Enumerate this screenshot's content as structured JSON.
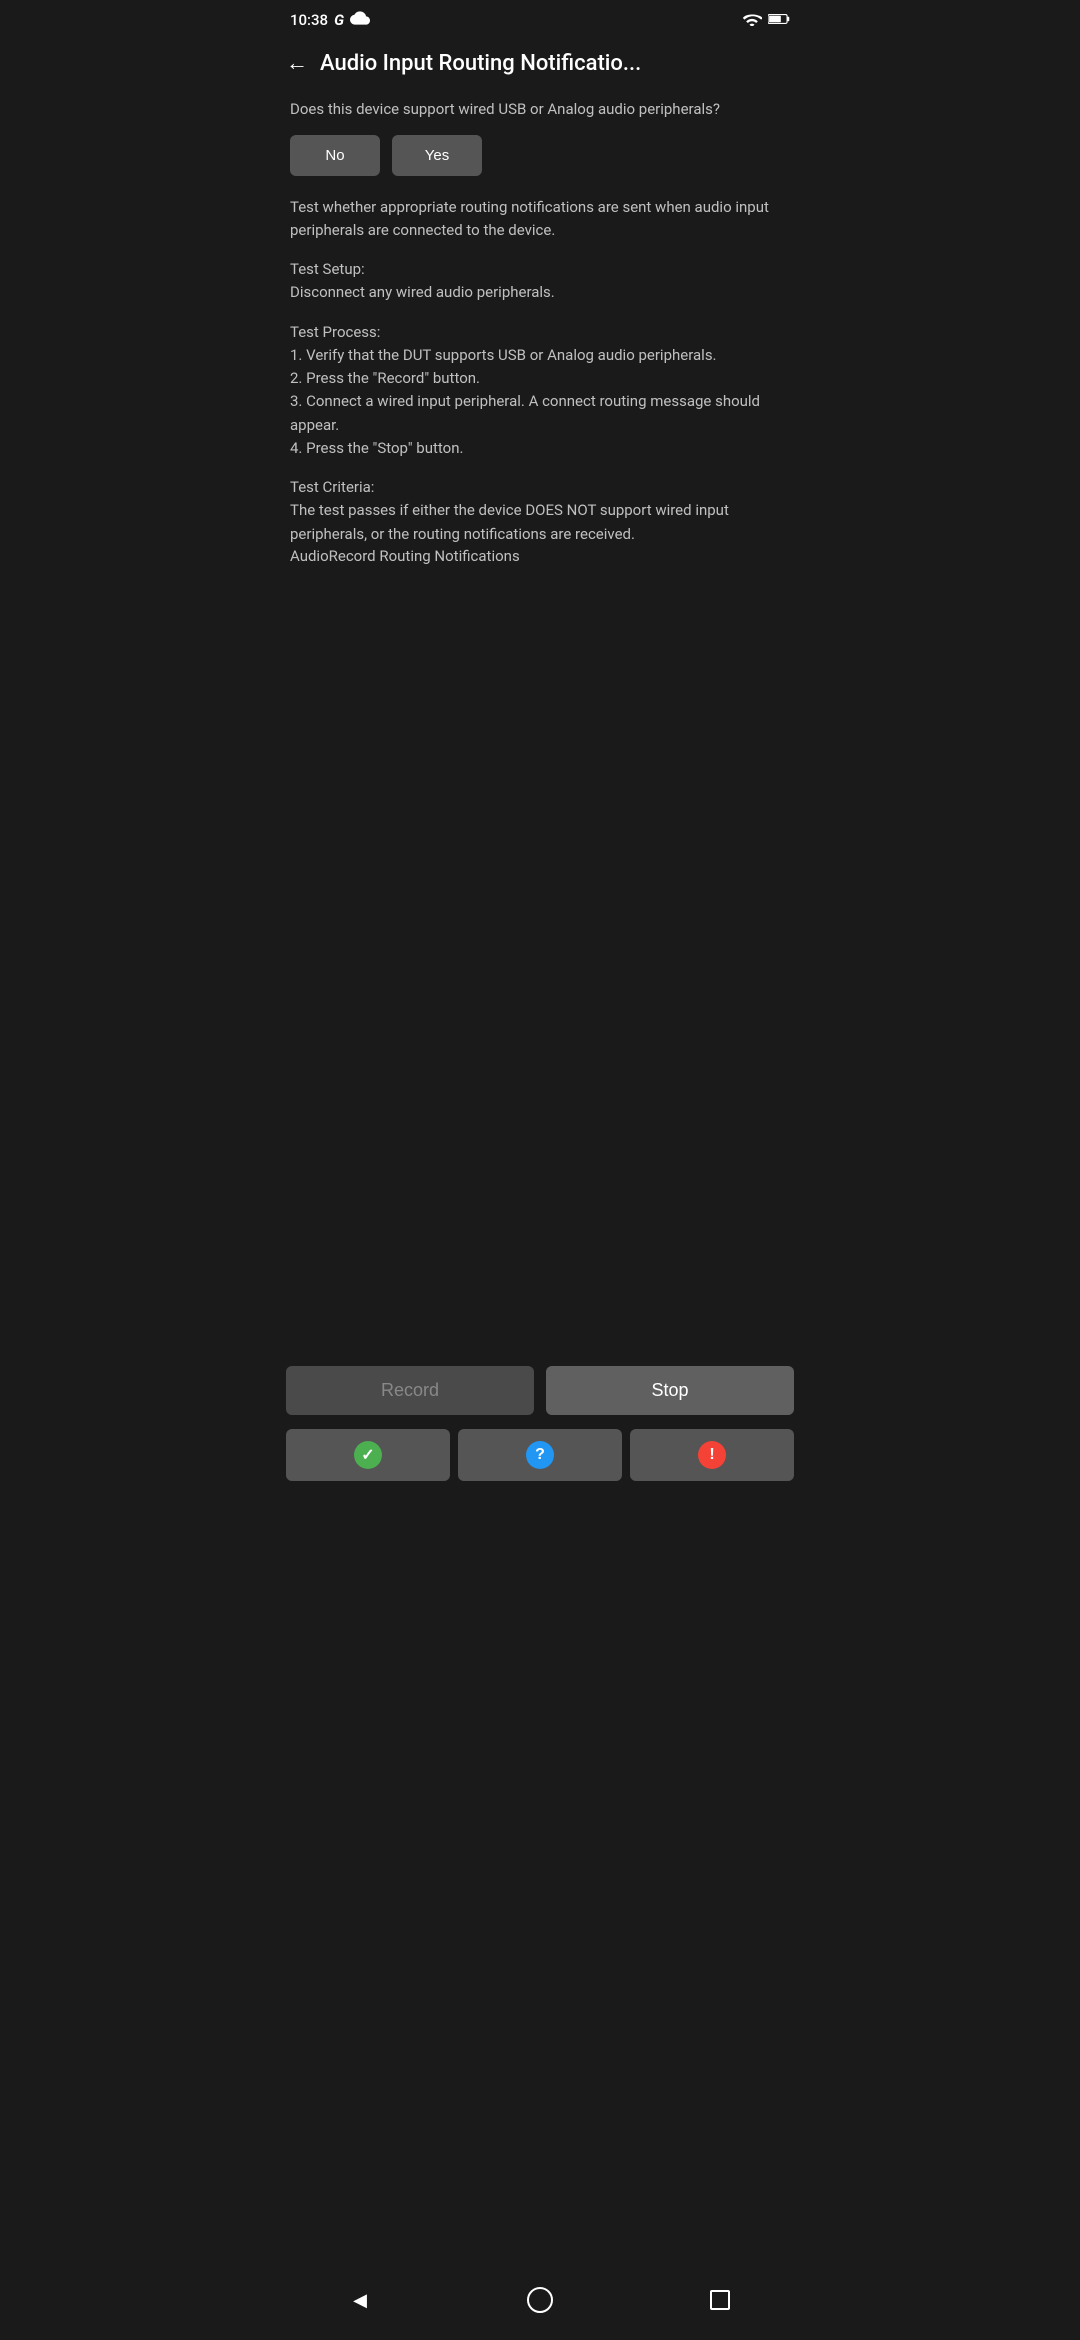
{
  "statusBar": {
    "time": "10:38",
    "googleLabel": "G",
    "cloudIcon": "cloud",
    "wifiIcon": "wifi",
    "batteryIcon": "battery"
  },
  "header": {
    "backLabel": "←",
    "title": "Audio Input Routing Notificatio..."
  },
  "content": {
    "questionText": "Does this device support wired USB or Analog audio peripherals?",
    "noButtonLabel": "No",
    "yesButtonLabel": "Yes",
    "descriptionText": "Test whether appropriate routing notifications are sent when audio input peripherals are connected to the device.",
    "setupLabel": "Test Setup:",
    "setupText": "Disconnect any wired audio peripherals.",
    "processLabel": "Test Process:",
    "processText": "1. Verify that the DUT supports USB or Analog audio peripherals.\n2. Press the \"Record\" button.\n3. Connect a wired input peripheral. A connect routing message should appear.\n4. Press the \"Stop\" button.",
    "criteriaLabel": "Test Criteria:",
    "criteriaText": "The test passes if either the device DOES NOT support wired input peripherals, or the routing notifications are received.",
    "criteriaName": "AudioRecord Routing Notifications"
  },
  "actionButtons": {
    "recordLabel": "Record",
    "stopLabel": "Stop"
  },
  "resultButtons": {
    "passIcon": "✓",
    "infoIcon": "?",
    "failIcon": "!"
  },
  "navBar": {
    "backIcon": "◀",
    "homeIcon": "circle",
    "recentIcon": "square"
  }
}
